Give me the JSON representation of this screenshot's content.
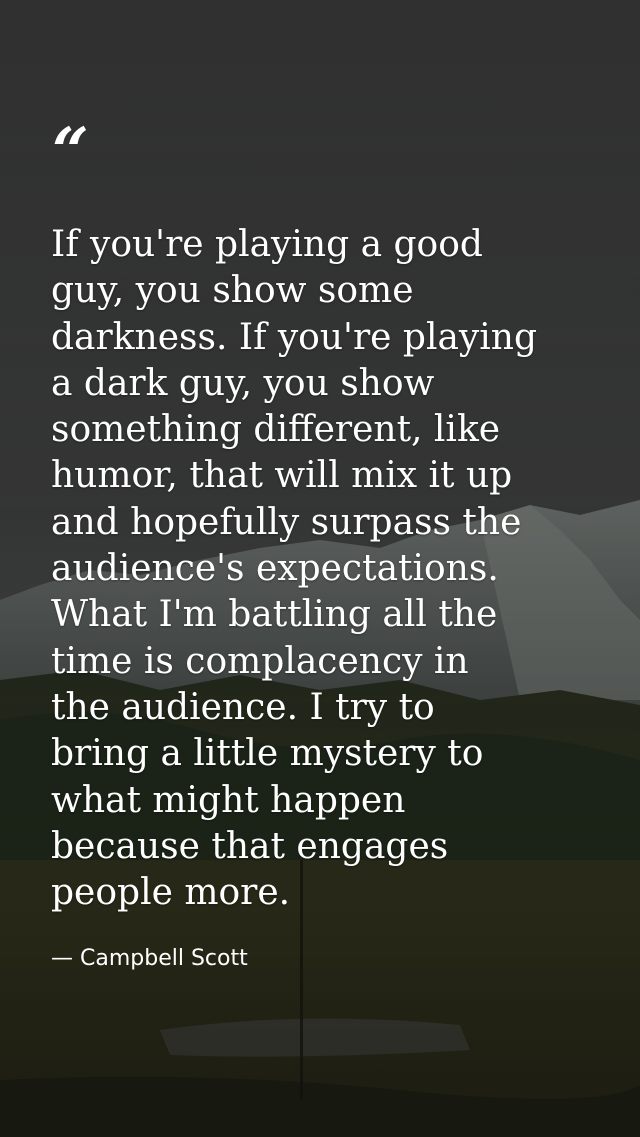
{
  "quote": {
    "mark": "“",
    "lines": [
      "If you're playing a good",
      "guy, you show some",
      "darkness. If you're playing",
      "a dark guy, you show",
      "something different, like",
      "humor, that will mix it up",
      "and hopefully surpass the",
      "audience's expectations.",
      "What I'm battling all the",
      "time is complacency in",
      "the audience. I try to",
      "bring a little mystery to",
      "what might happen",
      "because that engages",
      "people more."
    ],
    "attribution": "— Campbell Scott"
  },
  "colors": {
    "text": "#ffffff",
    "sky_top": "#3b3b3b",
    "sky_bottom": "#4a4d4c",
    "mountain": "#6b716f",
    "forest": "#2a3322",
    "field": "#4a4a2a"
  }
}
